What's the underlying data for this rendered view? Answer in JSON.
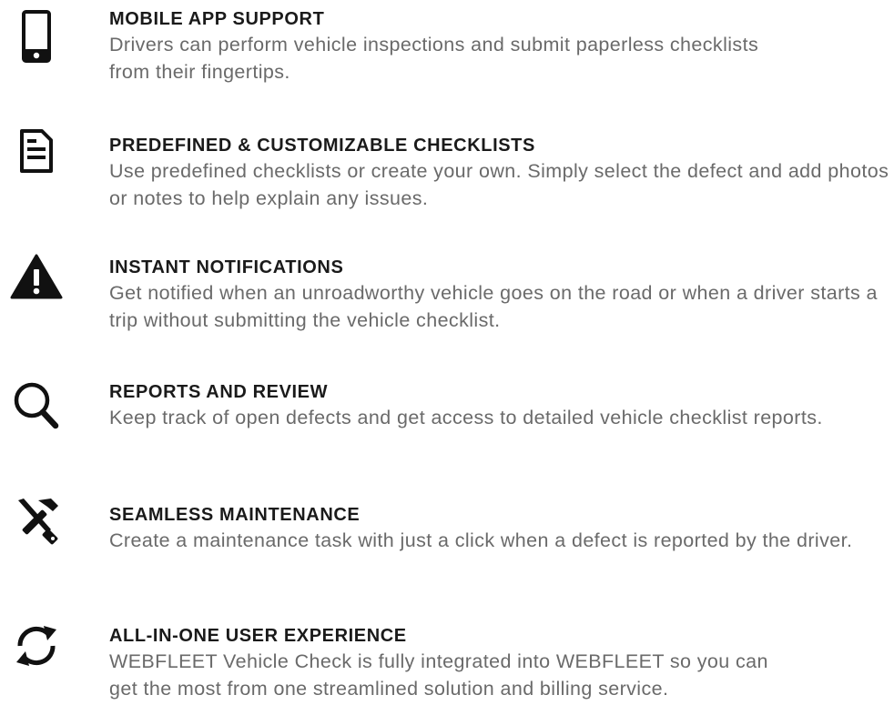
{
  "features": [
    {
      "icon": "mobile-phone-icon",
      "title": "MOBILE APP SUPPORT",
      "description": "Drivers can perform vehicle inspections and submit paperless checklists from their fingertips."
    },
    {
      "icon": "document-icon",
      "title": "PREDEFINED & CUSTOMIZABLE CHECKLISTS",
      "description": "Use predefined checklists or create your own. Simply select the defect and add photos or notes to help explain any issues."
    },
    {
      "icon": "warning-icon",
      "title": "INSTANT NOTIFICATIONS",
      "description": "Get notified when an unroadworthy vehicle goes on the road or when a driver starts a trip without submitting the vehicle checklist."
    },
    {
      "icon": "search-icon",
      "title": "REPORTS AND REVIEW",
      "description": "Keep track of open defects and get access to detailed vehicle checklist reports."
    },
    {
      "icon": "tools-icon",
      "title": "SEAMLESS MAINTENANCE",
      "description": "Create a maintenance task with just a click when a defect is reported by the driver."
    },
    {
      "icon": "sync-icon",
      "title": "ALL-IN-ONE USER EXPERIENCE",
      "description": "WEBFLEET Vehicle Check is fully integrated into WEBFLEET so you can get the most from one streamlined solution and billing service."
    }
  ]
}
